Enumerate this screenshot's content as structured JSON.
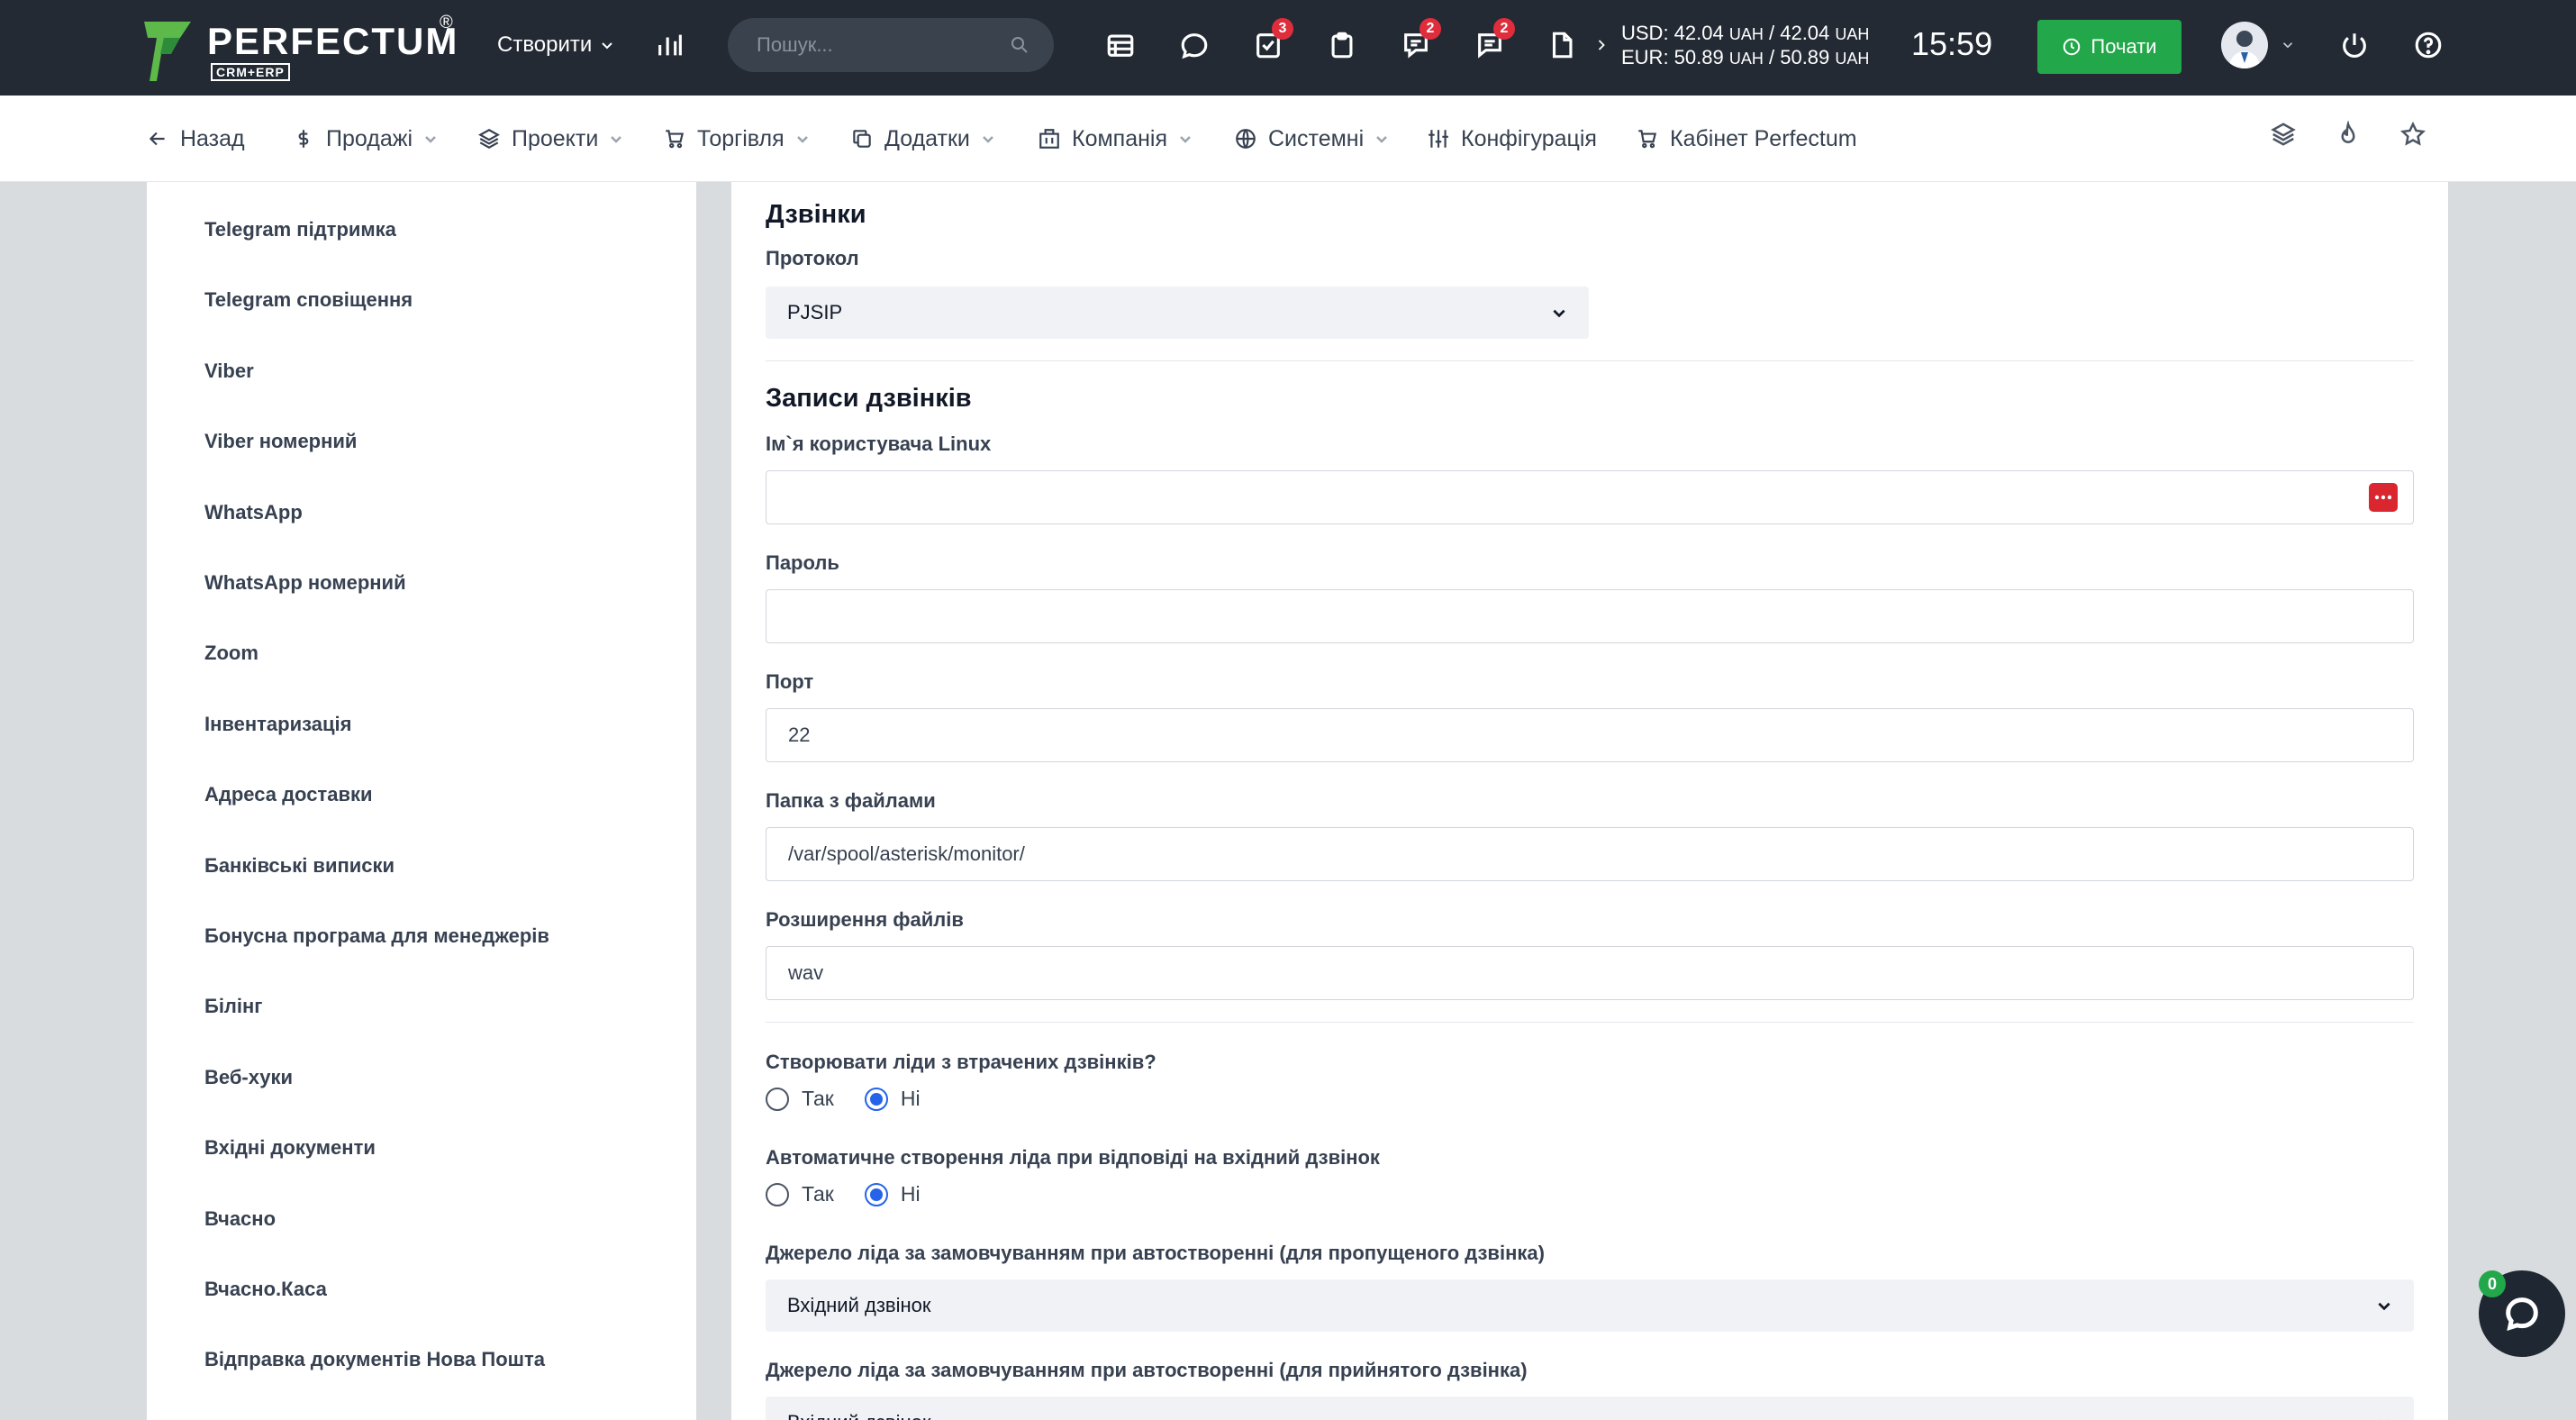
{
  "brand": {
    "name": "PERFECTUM",
    "sub": "CRM+ERP",
    "reg": "®"
  },
  "header": {
    "create_label": "Створити",
    "search_placeholder": "Пошук...",
    "badges": {
      "tasks": "3",
      "chat": "2",
      "messages": "2"
    },
    "rates": {
      "usd": "USD: 42.04",
      "usd2": "/ 42.04",
      "eur": "EUR: 50.89",
      "eur2": "/ 50.89",
      "currency": "UAH"
    },
    "time": "15:59",
    "start_label": "Почати"
  },
  "nav": {
    "back": "Назад",
    "sales": "Продажі",
    "projects": "Проекти",
    "trade": "Торгівля",
    "addons": "Додатки",
    "company": "Компанія",
    "system": "Системні",
    "config": "Конфігурація",
    "cabinet": "Кабінет Perfectum"
  },
  "sidebar": {
    "items": [
      "Telegram підтримка",
      "Telegram сповіщення",
      "Viber",
      "Viber номерний",
      "WhatsApp",
      "WhatsApp номерний",
      "Zoom",
      "Інвентаризація",
      "Адреса доставки",
      "Банківські виписки",
      "Бонусна програма для менеджерів",
      "Білінг",
      "Веб-хуки",
      "Вхідні документи",
      "Вчасно",
      "Вчасно.Каса",
      "Відправка документів Нова Пошта"
    ]
  },
  "form": {
    "calls_title": "Дзвінки",
    "protocol_label": "Протокол",
    "protocol_value": "PJSIP",
    "records_title": "Записи дзвінків",
    "linux_user_label": "Ім`я користувача Linux",
    "linux_user_value": "",
    "password_label": "Пароль",
    "password_value": "",
    "port_label": "Порт",
    "port_value": "22",
    "folder_label": "Папка з файлами",
    "folder_value": "/var/spool/asterisk/monitor/",
    "ext_label": "Розширення файлів",
    "ext_value": "wav",
    "missed_label": "Створювати ліди з втрачених дзвінків?",
    "auto_label": "Автоматичне створення ліда при відповіді на вхідний дзвінок",
    "yes": "Так",
    "no": "Ні",
    "missed_selected": "no",
    "auto_selected": "no",
    "source_missed_label": "Джерело ліда за замовчуванням при автостворенні (для пропущеного дзвінка)",
    "source_missed_value": "Вхідний дзвінок",
    "source_accepted_label": "Джерело ліда за замовчуванням при автостворенні (для прийнятого дзвінка)",
    "source_accepted_value": "Вхідний дзвінок"
  },
  "chat_count": "0",
  "colors": {
    "topbar": "#232a34",
    "accent_green": "#22a74a",
    "badge_red": "#e02d3c",
    "radio_blue": "#2563eb"
  }
}
